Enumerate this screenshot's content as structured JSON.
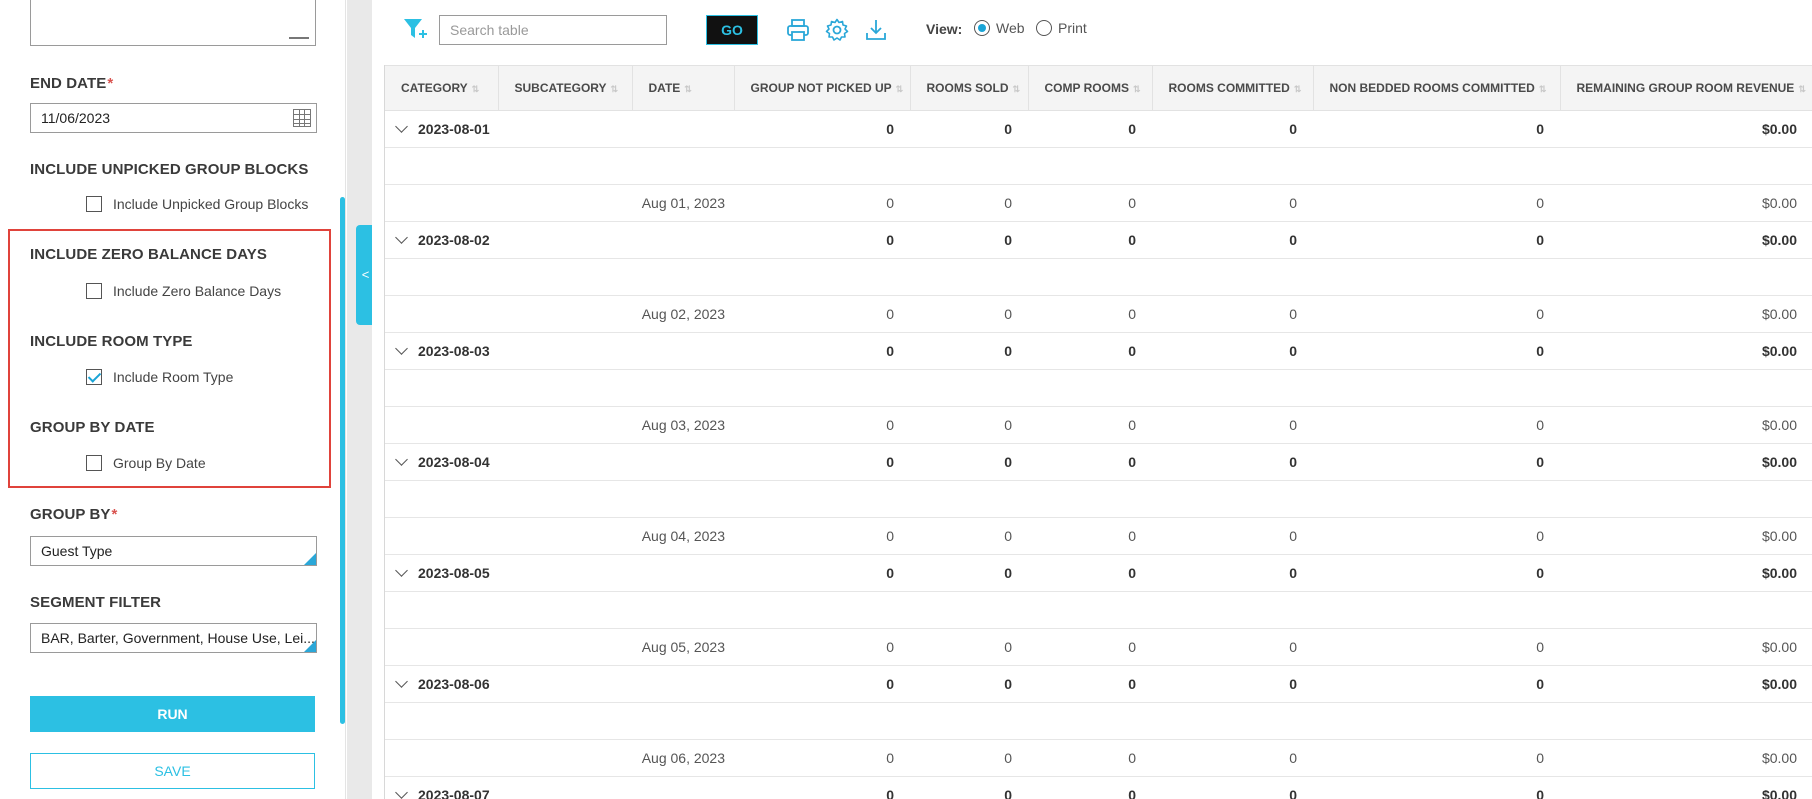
{
  "sidebar": {
    "end_date_label": "END DATE",
    "end_date_value": "11/06/2023",
    "unpicked_label": "INCLUDE UNPICKED GROUP BLOCKS",
    "unpicked_checkbox": "Include Unpicked Group Blocks",
    "zero_balance_label": "INCLUDE ZERO BALANCE DAYS",
    "zero_balance_checkbox": "Include Zero Balance Days",
    "room_type_label": "INCLUDE ROOM TYPE",
    "room_type_checkbox": "Include Room Type",
    "group_by_date_label": "GROUP BY DATE",
    "group_by_date_checkbox": "Group By Date",
    "group_by_label": "GROUP BY",
    "group_by_value": "Guest Type",
    "segment_filter_label": "SEGMENT FILTER",
    "segment_filter_value": "BAR, Barter, Government, House Use, Lei...",
    "required_mark": "*",
    "run_label": "RUN",
    "save_label": "SAVE",
    "checks": {
      "unpicked": false,
      "zero_balance": false,
      "room_type": true,
      "group_by_date": false
    },
    "collapse_glyph": "<"
  },
  "toolbar": {
    "search_placeholder": "Search table",
    "go_label": "GO",
    "view_label": "View:",
    "view_web": "Web",
    "view_print": "Print",
    "selected_view": "Web"
  },
  "table": {
    "columns": [
      "CATEGORY",
      "SUBCATEGORY",
      "DATE",
      "GROUP NOT PICKED UP",
      "ROOMS SOLD",
      "COMP ROOMS",
      "ROOMS COMMITTED",
      "NON BEDDED ROOMS COMMITTED",
      "REMAINING GROUP ROOM REVENUE"
    ],
    "groups": [
      {
        "label": "2023-08-01",
        "date": "Aug 01, 2023"
      },
      {
        "label": "2023-08-02",
        "date": "Aug 02, 2023"
      },
      {
        "label": "2023-08-03",
        "date": "Aug 03, 2023"
      },
      {
        "label": "2023-08-04",
        "date": "Aug 04, 2023"
      },
      {
        "label": "2023-08-05",
        "date": "Aug 05, 2023"
      },
      {
        "label": "2023-08-06",
        "date": "Aug 06, 2023"
      },
      {
        "label": "2023-08-07",
        "date": ""
      }
    ],
    "values": [
      "0",
      "0",
      "0",
      "0",
      "0",
      "$0.00"
    ]
  },
  "colors": {
    "accent": "#2cc0e3",
    "highlight": "#e0433b",
    "go_bg": "#111111"
  }
}
